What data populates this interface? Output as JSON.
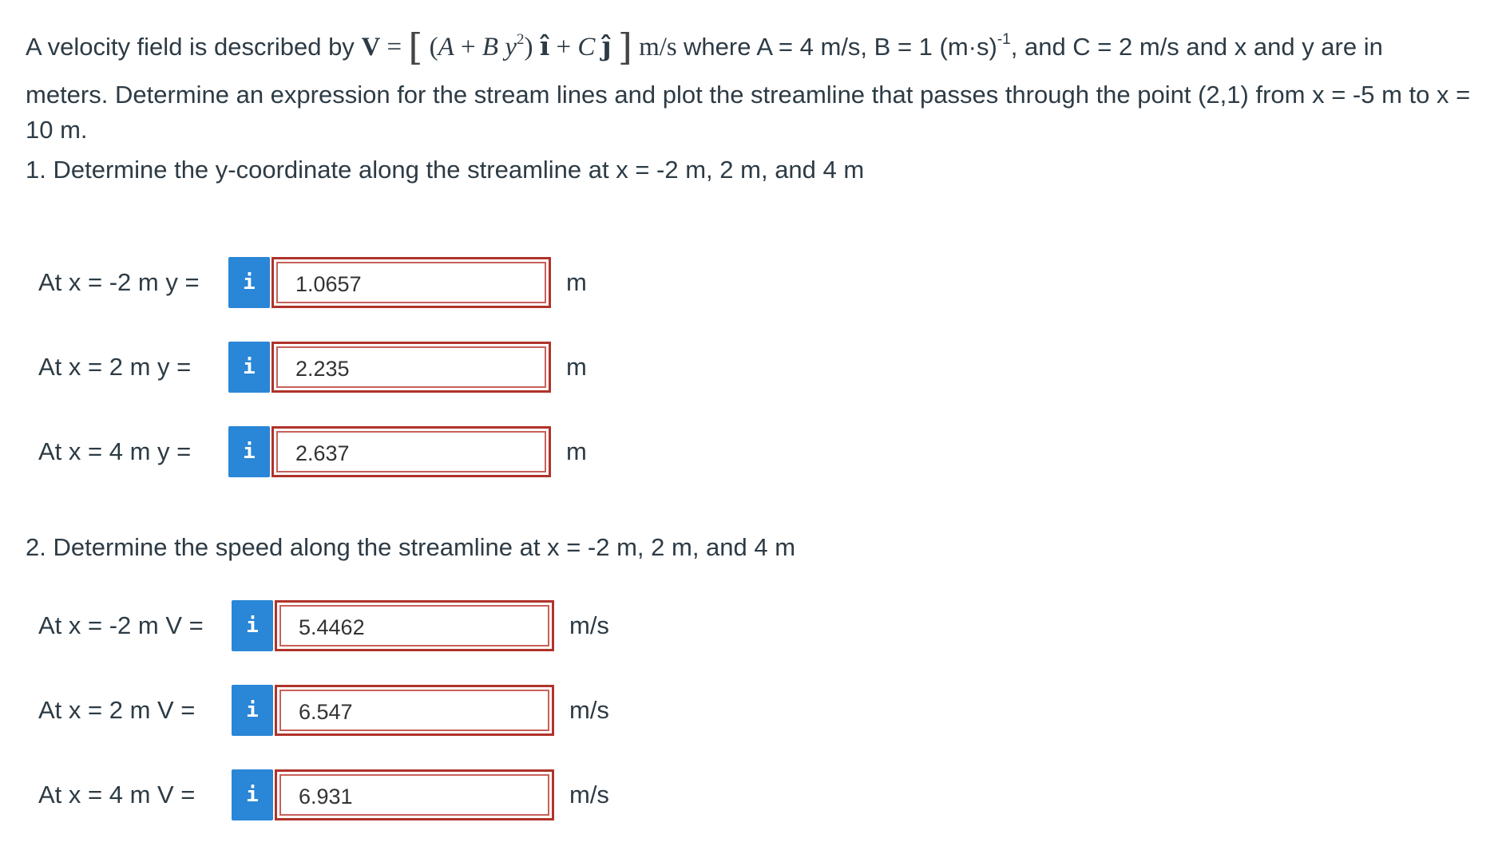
{
  "problem": {
    "intro": "A velocity field is described by",
    "equation_V": "V",
    "equation_A": "A",
    "equation_plus": "+",
    "equation_B": "B",
    "equation_y": "y",
    "equation_exp": "2",
    "equation_i": "î",
    "equation_C": "C",
    "equation_j": "ĵ",
    "equation_units": "m/s",
    "params_text": "where A = 4 m/s, B = 1 (m·s)",
    "params_exp": "-1",
    "params_text2": ", and C = 2 m/s and x and y are in",
    "line2": "meters. Determine an expression for the stream lines and plot the streamline that passes through the point (2,1) from x = -5 m to x =",
    "line3": "10 m."
  },
  "question1": {
    "text": "1.  Determine the y-coordinate along the streamline at x = -2 m, 2 m, and 4 m",
    "rows": [
      {
        "label": "At x = -2 m y =",
        "value": "1.0657",
        "unit": "m"
      },
      {
        "label": "At x = 2 m y =",
        "value": "2.235",
        "unit": "m"
      },
      {
        "label": "At x = 4 m y =",
        "value": "2.637",
        "unit": "m"
      }
    ]
  },
  "question2": {
    "text": "2.  Determine the speed along the streamline at x = -2 m, 2 m, and 4 m",
    "rows": [
      {
        "label": "At x = -2 m V =",
        "value": "5.4462",
        "unit": "m/s"
      },
      {
        "label": "At x = 2 m V =",
        "value": "6.547",
        "unit": "m/s"
      },
      {
        "label": "At x = 4 m V =",
        "value": "6.931",
        "unit": "m/s"
      }
    ]
  },
  "info_glyph": "i",
  "colors": {
    "info_button": "#2a86d6",
    "field_border": "#b0332a",
    "text": "#2d3b45"
  }
}
